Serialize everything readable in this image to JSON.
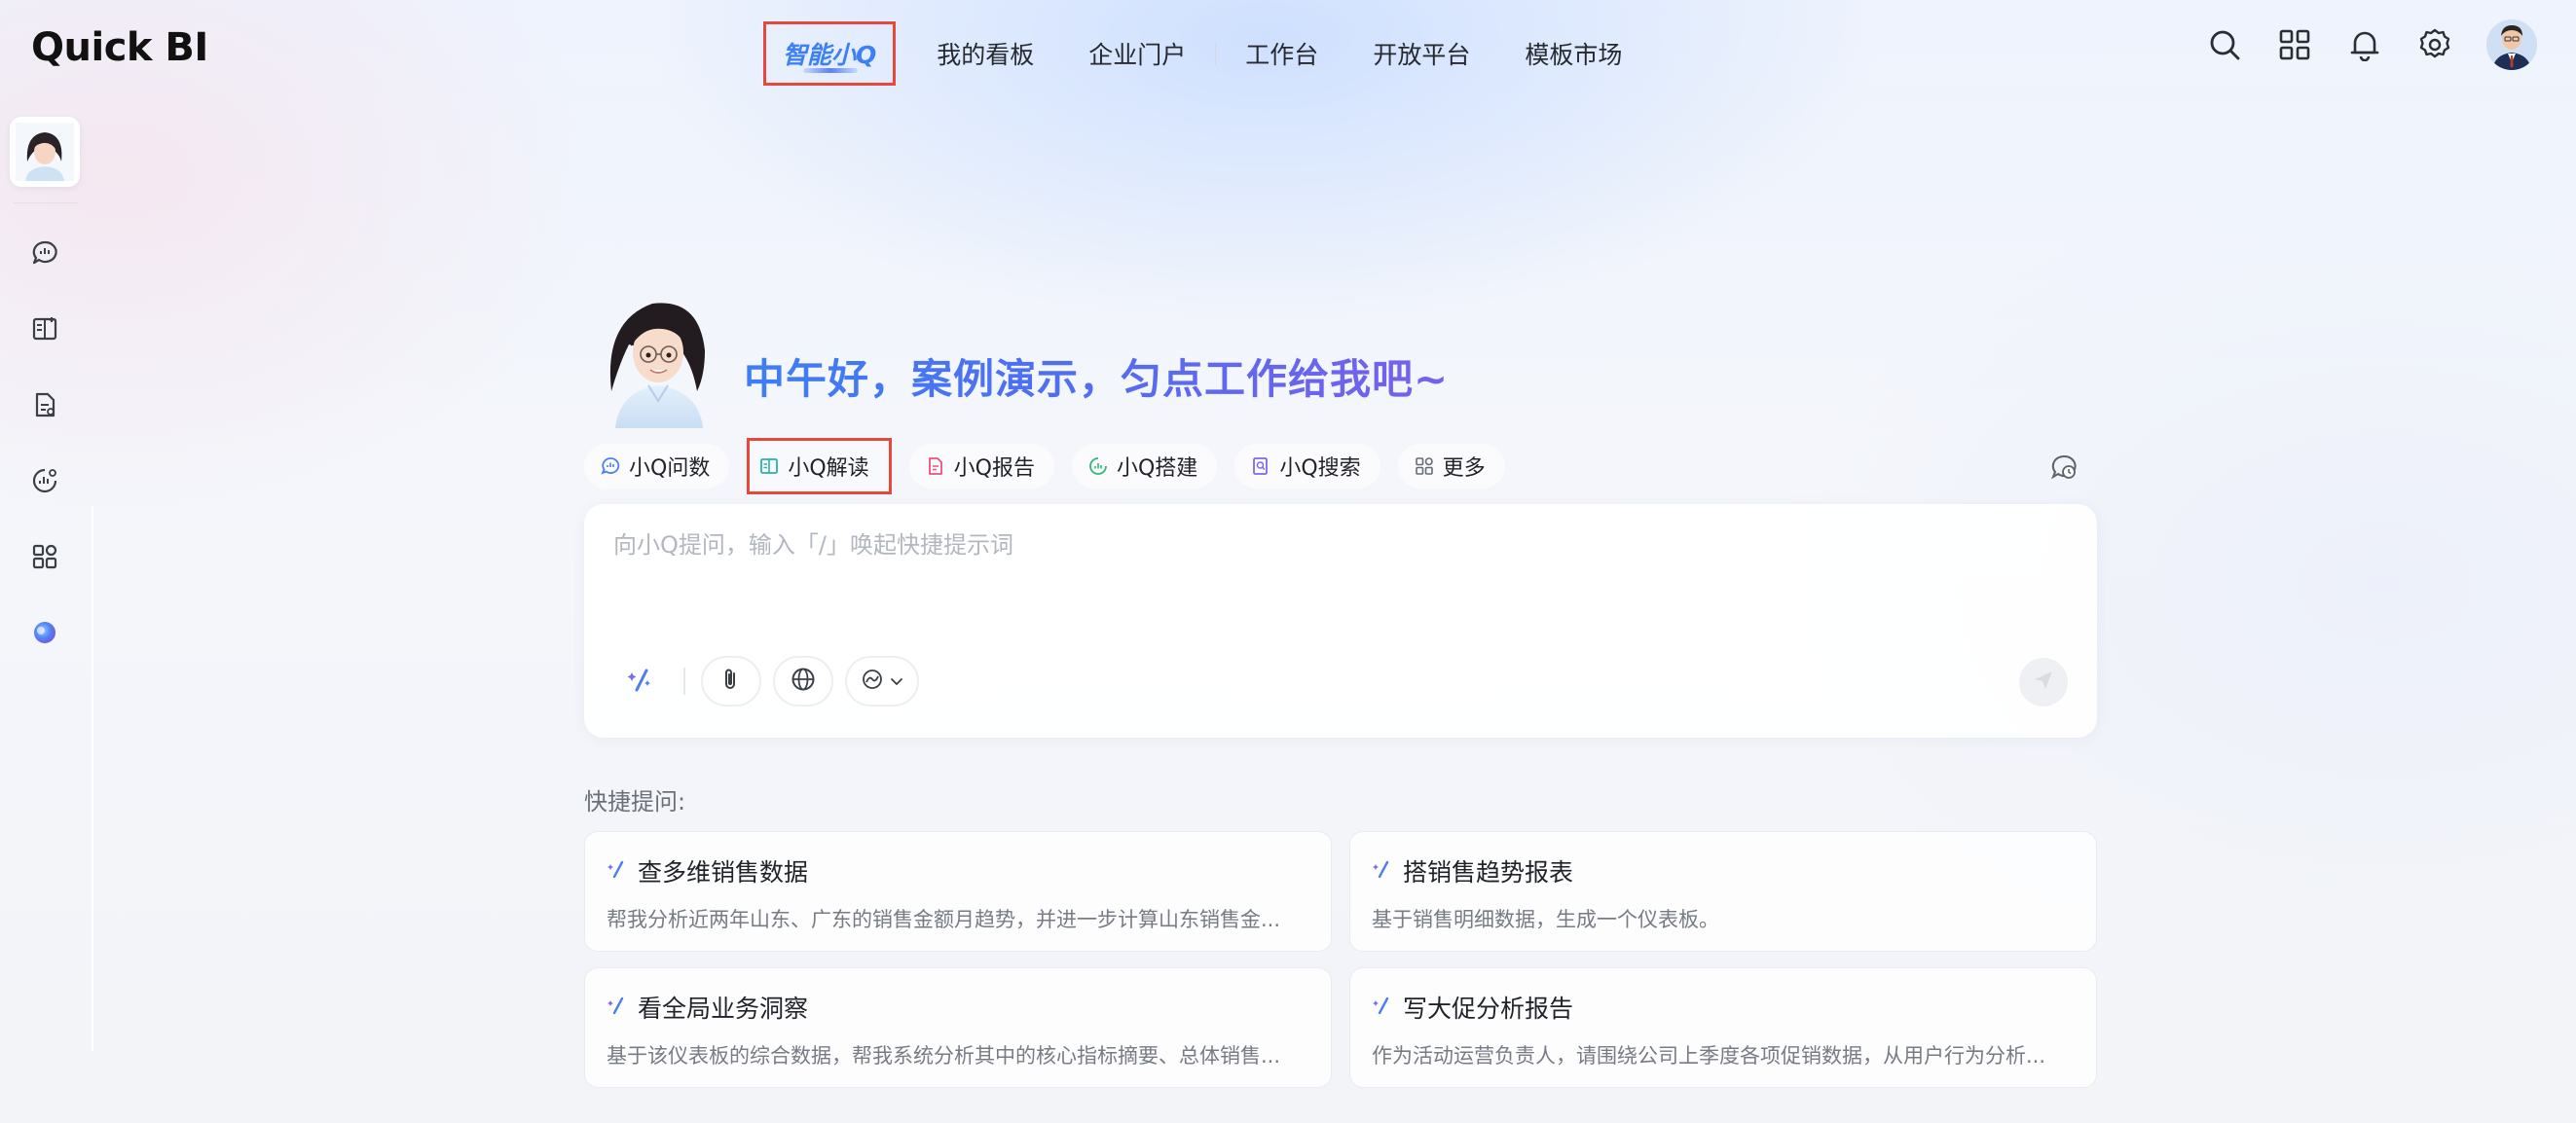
{
  "app": {
    "logo_text": "Quick BI"
  },
  "nav": {
    "items": [
      {
        "label": "智能小Q",
        "active": true
      },
      {
        "label": "我的看板"
      },
      {
        "label": "企业门户"
      },
      {
        "label": "工作台"
      },
      {
        "label": "开放平台"
      },
      {
        "label": "模板市场"
      }
    ]
  },
  "header_icons": [
    "search-icon",
    "apps-grid-icon",
    "bell-icon",
    "gear-icon",
    "user-avatar"
  ],
  "sidebar": {
    "icons": [
      "assistant-avatar",
      "chat-data-icon",
      "interpret-icon",
      "report-icon",
      "build-icon",
      "more-grid-icon",
      "orb-icon"
    ]
  },
  "main": {
    "greeting": "中午好，案例演示，匀点工作给我吧~",
    "chips": [
      {
        "label": "小Q问数",
        "icon": "chat-data-icon",
        "color": "#4d7ef0"
      },
      {
        "label": "小Q解读",
        "icon": "interpret-icon",
        "color": "#27b3a5"
      },
      {
        "label": "小Q报告",
        "icon": "report-icon",
        "color": "#e8547a"
      },
      {
        "label": "小Q搭建",
        "icon": "build-icon",
        "color": "#2fb87a"
      },
      {
        "label": "小Q搜索",
        "icon": "search-doc-icon",
        "color": "#7a6bea"
      },
      {
        "label": "更多",
        "icon": "more-grid-icon",
        "color": "#666c76"
      }
    ],
    "input_placeholder": "向小Q提问，输入「/」唤起快捷提示词",
    "quick_label": "快捷提问:",
    "prompts": [
      {
        "title": "查多维销售数据",
        "desc": "帮我分析近两年山东、广东的销售金额月趋势，并进一步计算山东销售金..."
      },
      {
        "title": "搭销售趋势报表",
        "desc": "基于销售明细数据，生成一个仪表板。"
      },
      {
        "title": "看全局业务洞察",
        "desc": "基于该仪表板的综合数据，帮我系统分析其中的核心指标摘要、总体销售..."
      },
      {
        "title": "写大促分析报告",
        "desc": "作为活动运营负责人，请围绕公司上季度各项促销数据，从用户行为分析..."
      }
    ]
  },
  "colors": {
    "accent": "#3d7ff5",
    "highlight_box": "#e8473c"
  }
}
